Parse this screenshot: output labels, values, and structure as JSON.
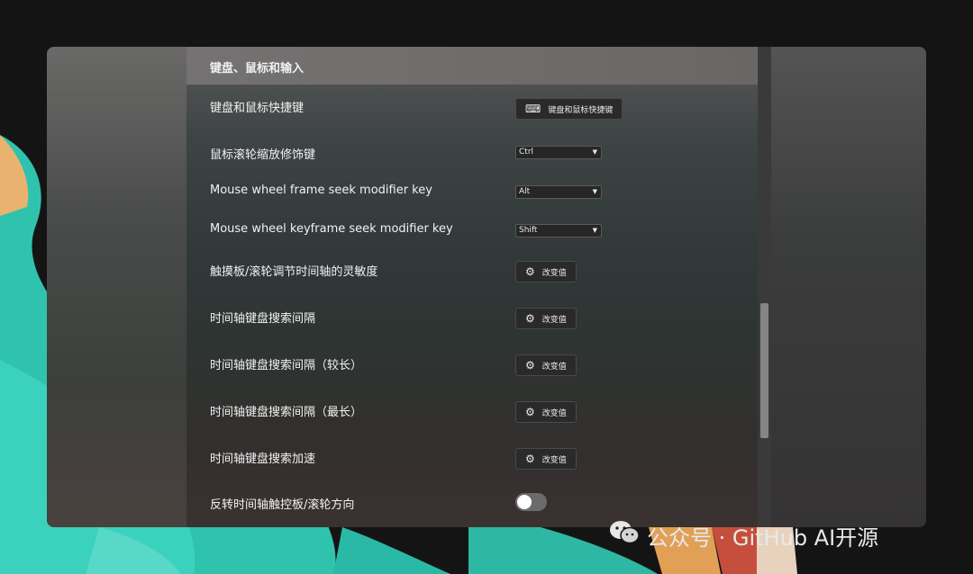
{
  "section": {
    "title": "键盘、鼠标和输入"
  },
  "settings": {
    "shortcuts_label": "键盘和鼠标快捷键",
    "shortcuts_button": "键盘和鼠标快捷键",
    "zoom_modifier_label": "鼠标滚轮缩放修饰键",
    "zoom_modifier_value": "Ctrl",
    "frame_seek_label": "Mouse wheel frame seek modifier key",
    "frame_seek_value": "Alt",
    "keyframe_seek_label": "Mouse wheel keyframe seek modifier key",
    "keyframe_seek_value": "Shift",
    "sensitivity_label": "触摸板/滚轮调节时间轴的灵敏度",
    "sensitivity_button": "改变值",
    "search_interval_label": "时间轴键盘搜索间隔",
    "search_interval_button": "改变值",
    "search_interval_long_label": "时间轴键盘搜索间隔（较长）",
    "search_interval_long_button": "改变值",
    "search_interval_longest_label": "时间轴键盘搜索间隔（最长）",
    "search_interval_longest_button": "改变值",
    "search_accel_label": "时间轴键盘搜索加速",
    "search_accel_button": "改变值",
    "reverse_label": "反转时间轴触控板/滚轮方向",
    "reverse_on": false
  },
  "icons": {
    "keyboard": "keyboard-icon",
    "gear": "gear-icon",
    "wechat": "wechat-icon"
  },
  "watermark": {
    "text": "公众号 · GitHub AI开源"
  }
}
